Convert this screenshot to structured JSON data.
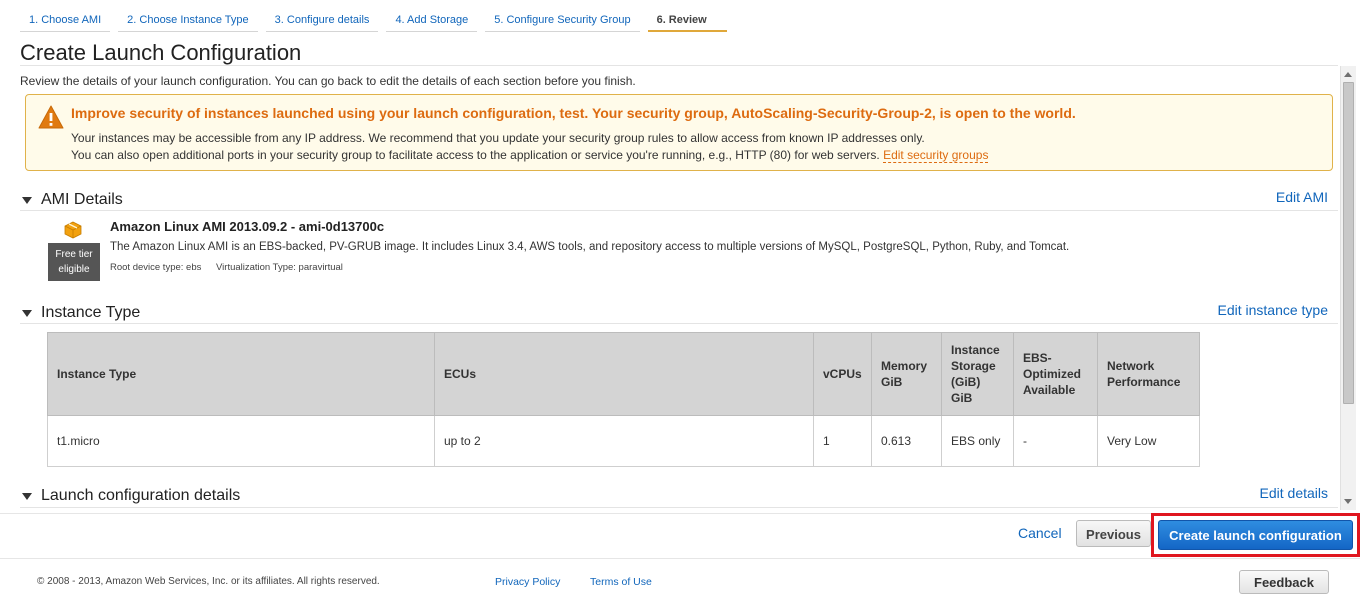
{
  "wizard": {
    "steps": [
      "1. Choose AMI",
      "2. Choose Instance Type",
      "3. Configure details",
      "4. Add Storage",
      "5. Configure Security Group",
      "6. Review"
    ],
    "active_step": "6. Review"
  },
  "page": {
    "title": "Create Launch Configuration",
    "subtitle": "Review the details of your launch configuration. You can go back to edit the details of each section before you finish."
  },
  "warning": {
    "title": "Improve security of instances launched using your launch configuration, test. Your security group, AutoScaling-Security-Group-2, is open to the world.",
    "line1": "Your instances may be accessible from any IP address. We recommend that you update your security group rules to allow access from known IP addresses only.",
    "line2": "You can also open additional ports in your security group to facilitate access to the application or service you're running, e.g., HTTP (80) for web servers.",
    "link": "Edit security groups",
    "icon": "warning-triangle-icon",
    "color": "#dd6b10"
  },
  "ami_section": {
    "heading": "AMI Details",
    "edit": "Edit AMI",
    "name": "Amazon Linux AMI 2013.09.2 - ami-0d13700c",
    "badge_line1": "Free tier",
    "badge_line2": "eligible",
    "description": "The Amazon Linux AMI is an EBS-backed, PV-GRUB image. It includes Linux 3.4, AWS tools, and repository access to multiple versions of MySQL, PostgreSQL, Python, Ruby, and Tomcat.",
    "root_device": "Root device type: ebs",
    "virtualization": "Virtualization Type: paravirtual"
  },
  "instance_section": {
    "heading": "Instance Type",
    "edit": "Edit instance type",
    "columns": [
      "Instance Type",
      "ECUs",
      "vCPUs",
      "Memory GiB",
      "Instance Storage (GiB) GiB",
      "EBS-Optimized Available",
      "Network Performance"
    ],
    "row": {
      "type": "t1.micro",
      "ecus": "up to 2",
      "vcpus": "1",
      "memory": "0.613",
      "storage": "EBS only",
      "ebs_optimized": "-",
      "network": "Very Low"
    }
  },
  "launch_section": {
    "heading": "Launch configuration details",
    "edit": "Edit details"
  },
  "actions": {
    "cancel": "Cancel",
    "previous": "Previous",
    "create": "Create launch configuration"
  },
  "footer": {
    "copyright": "© 2008 - 2013, Amazon Web Services, Inc. or its affiliates. All rights reserved.",
    "privacy": "Privacy Policy",
    "terms": "Terms of Use",
    "feedback": "Feedback"
  },
  "colors": {
    "link": "#1166bb",
    "primary_button": "#1a73d0",
    "highlight_box": "#e0161f",
    "warning_bg": "#fffbea"
  }
}
